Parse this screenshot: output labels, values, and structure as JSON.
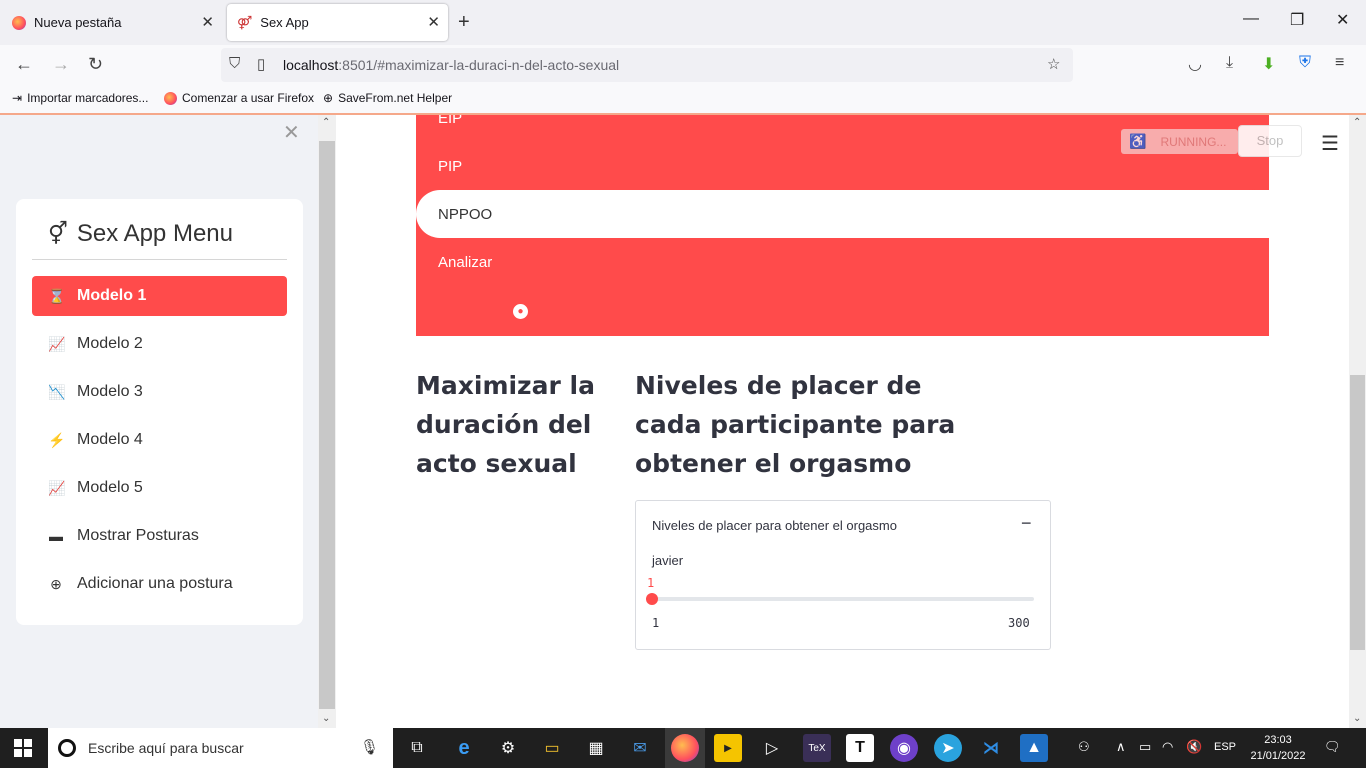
{
  "browser": {
    "tabs": [
      {
        "label": "Nueva pestaña",
        "active": false
      },
      {
        "label": "Sex App",
        "active": true
      }
    ],
    "url_host": "localhost",
    "url_rest": ":8501/#maximizar-la-duraci-n-del-acto-sexual",
    "bookmarks": [
      {
        "label": "Importar marcadores...",
        "icon": "import-icon"
      },
      {
        "label": "Comenzar a usar Firefox",
        "icon": "firefox-icon"
      },
      {
        "label": "SaveFrom.net Helper",
        "icon": "globe-icon"
      }
    ]
  },
  "sidebar": {
    "title": "Sex App Menu",
    "title_icon": "gender-icon",
    "items": [
      {
        "label": "Modelo 1",
        "icon": "hourglass-icon",
        "active": true
      },
      {
        "label": "Modelo 2",
        "icon": "graph-up-icon",
        "active": false
      },
      {
        "label": "Modelo 3",
        "icon": "graph-down-icon",
        "active": false
      },
      {
        "label": "Modelo 4",
        "icon": "lightning-icon",
        "active": false
      },
      {
        "label": "Modelo 5",
        "icon": "graph-up-icon",
        "active": false
      },
      {
        "label": "Mostrar Posturas",
        "icon": "folder-icon",
        "active": false
      },
      {
        "label": "Adicionar una postura",
        "icon": "plus-circle-icon",
        "active": false
      }
    ]
  },
  "topnav": {
    "items": [
      "EIP",
      "PIP",
      "NPPOO",
      "Analizar"
    ],
    "selected": "NPPOO",
    "user_icon": "person-circle-icon"
  },
  "status": {
    "running_label": "RUNNING...",
    "stop_label": "Stop"
  },
  "main": {
    "heading_left": "Maximizar la duración del acto sexual",
    "heading_right": "Niveles de placer de cada participante para obtener el orgasmo",
    "expander": {
      "title": "Niveles de placer para obtener el orgasmo",
      "slider": {
        "label": "javier",
        "value": "1",
        "min": "1",
        "max": "300"
      }
    }
  },
  "taskbar": {
    "search_placeholder": "Escribe aquí para buscar",
    "language": "ESP",
    "time": "23:03",
    "date": "21/01/2022"
  },
  "colors": {
    "accent": "#ff4b4b",
    "sidebar_bg": "#f0f2f6",
    "text": "#31333f"
  }
}
